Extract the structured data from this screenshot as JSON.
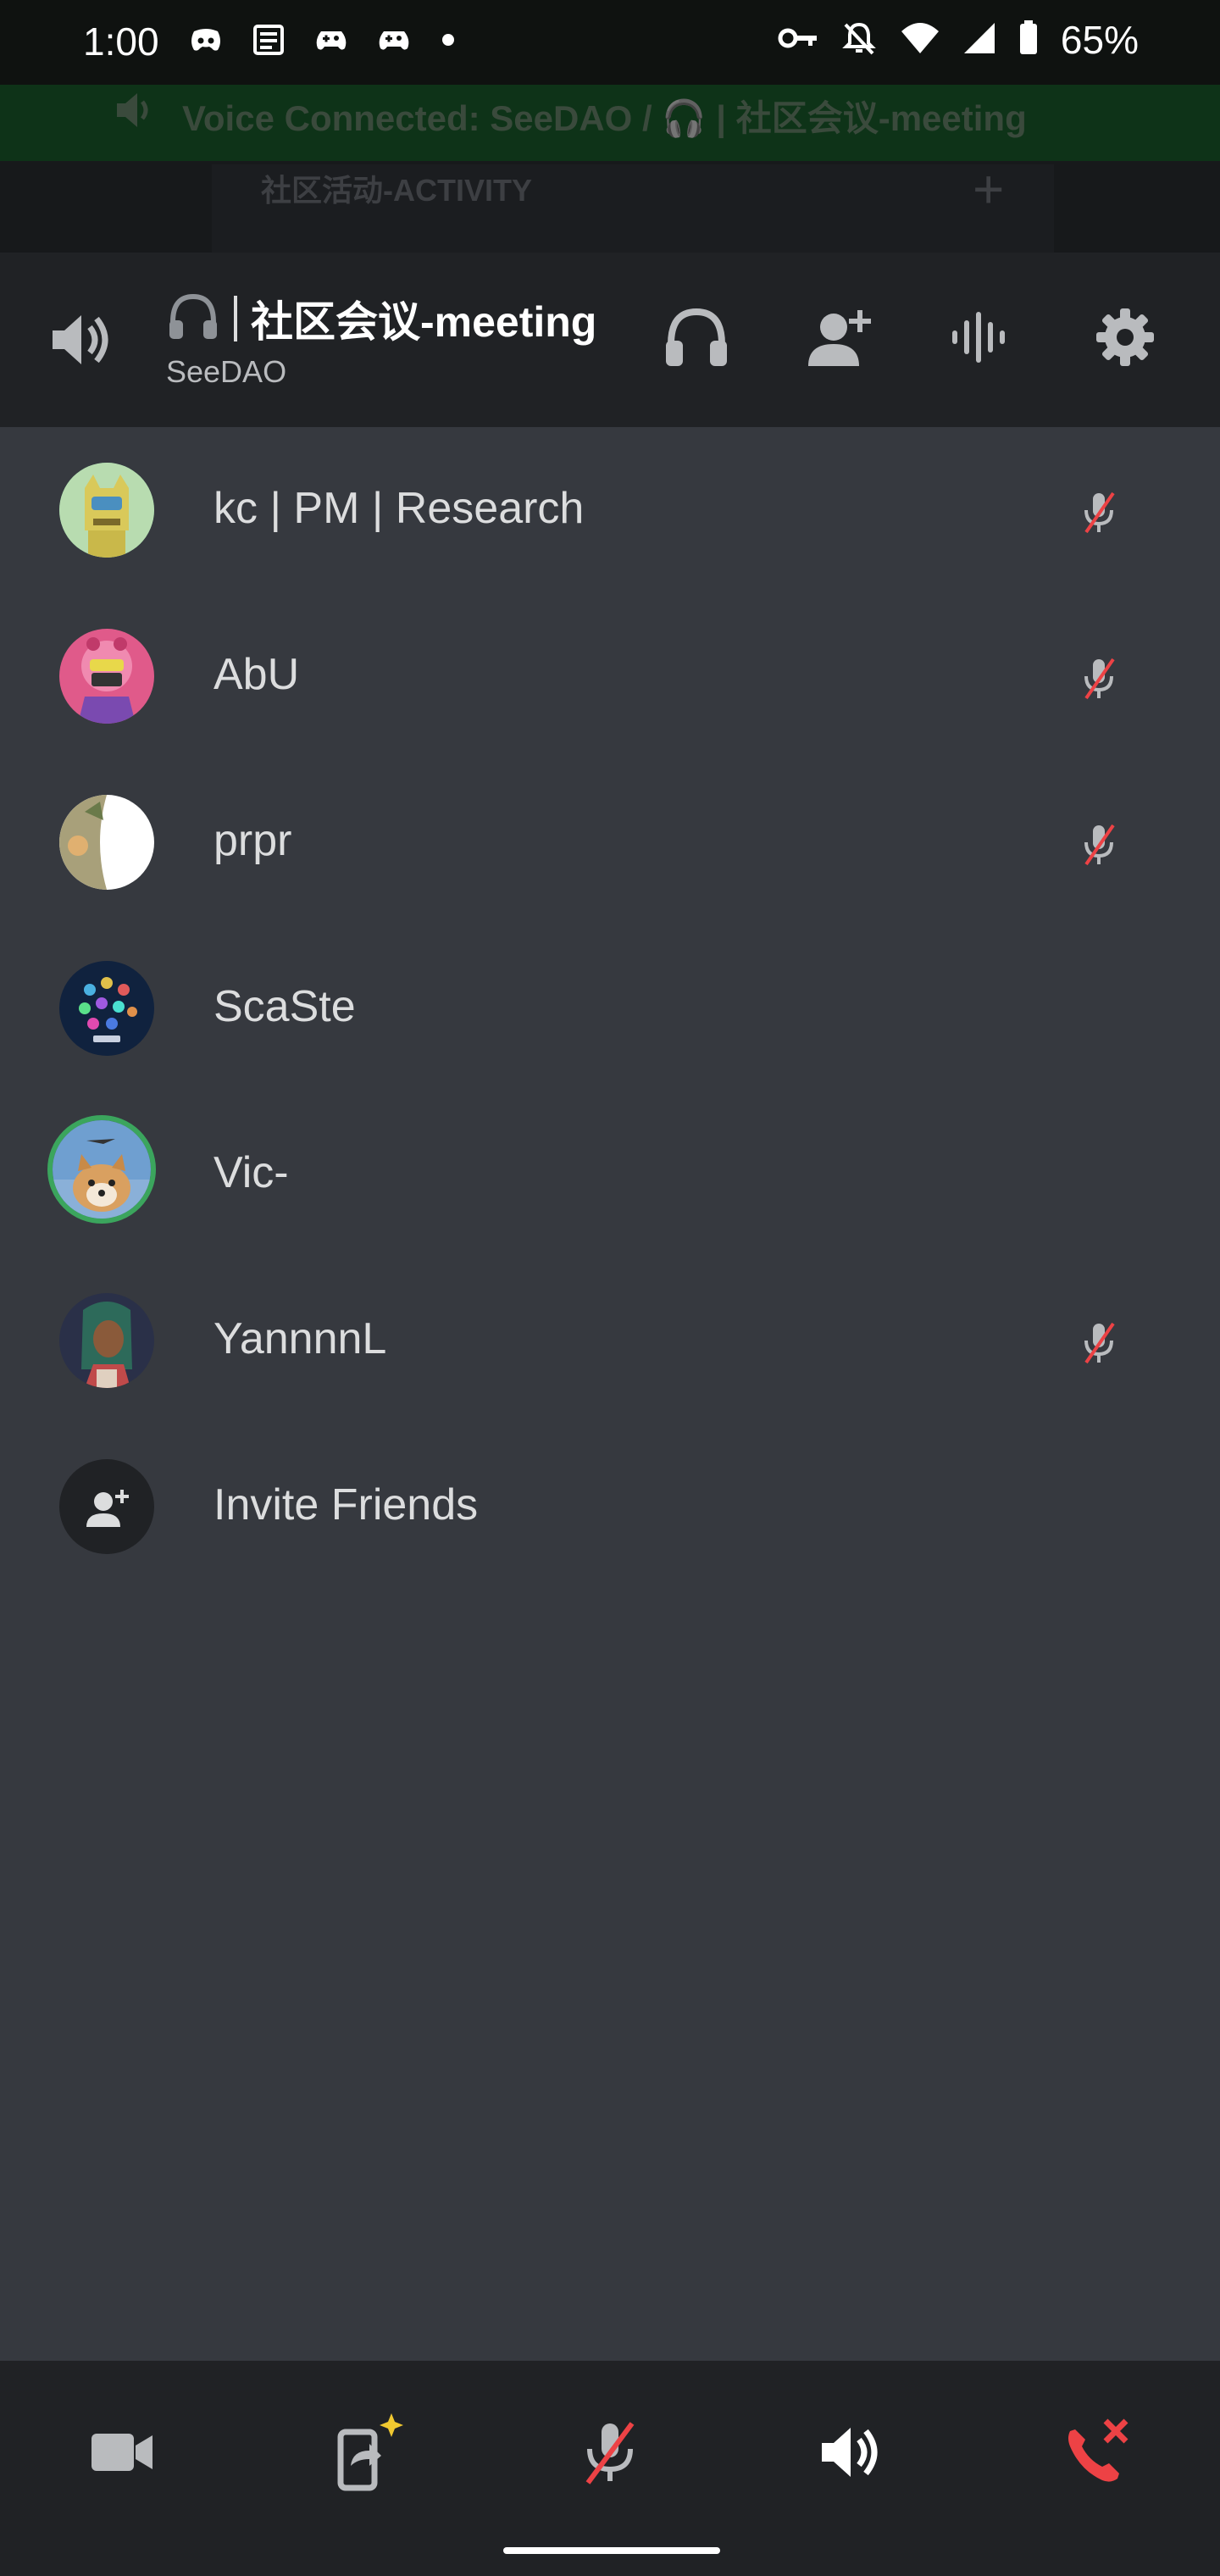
{
  "status_bar": {
    "time": "1:00",
    "battery": "65%"
  },
  "background": {
    "banner_text": "Voice Connected: SeeDAO / 🎧 | 社区会议-meeting",
    "category": "社区活动-ACTIVITY"
  },
  "header": {
    "channel_title": "社区会议-meeting",
    "server_name": "SeeDAO"
  },
  "participants": [
    {
      "name": "kc | PM | Research",
      "muted": true,
      "speaking": false,
      "avatar_color": "#d9c95a"
    },
    {
      "name": "AbU",
      "muted": true,
      "speaking": false,
      "avatar_color": "#e05a8a"
    },
    {
      "name": "prpr",
      "muted": true,
      "speaking": false,
      "avatar_color": "#a8a07a"
    },
    {
      "name": "ScaSte",
      "muted": false,
      "speaking": false,
      "avatar_color": "#10223e"
    },
    {
      "name": "Vic-",
      "muted": false,
      "speaking": true,
      "avatar_color": "#6f9fd0"
    },
    {
      "name": "YannnnL",
      "muted": true,
      "speaking": false,
      "avatar_color": "#2a3048"
    }
  ],
  "invite": {
    "label": "Invite Friends"
  },
  "toolbar": {
    "icons": [
      "video-camera-icon",
      "screen-share-icon",
      "mic-muted-icon",
      "speaker-icon",
      "disconnect-icon"
    ]
  },
  "colors": {
    "speaking_ring": "#3ba55d",
    "muted_red": "#ed4245",
    "header_bg": "#202225",
    "list_bg": "#36393f",
    "sparkle": "#f0c830"
  }
}
